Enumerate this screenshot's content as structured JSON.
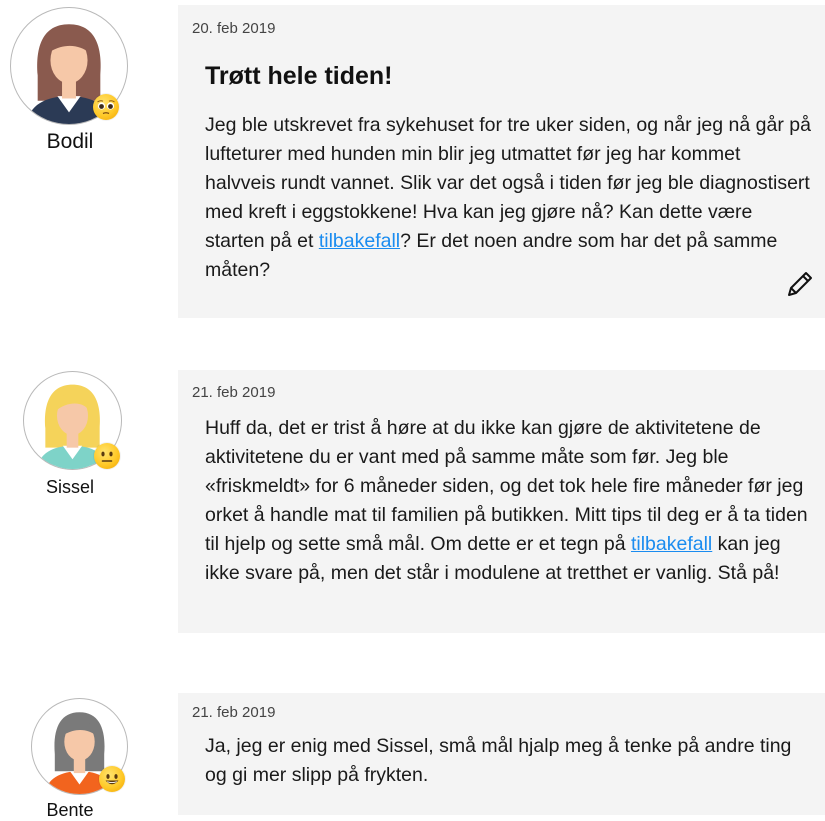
{
  "posts": [
    {
      "author": "Bodil",
      "mood_icon": "pleading-face-icon",
      "hair_color": "#8a5a4e",
      "shirt_color": "#2b3a55",
      "date": "20. feb 2019",
      "title": "Trøtt hele tiden!",
      "body_before": "Jeg ble utskrevet fra sykehuset for tre uker siden, og når jeg nå går på lufteturer med hunden min blir jeg utmattet før jeg har kommet halvveis rundt vannet. Slik var det også i tiden før jeg ble diagnostisert med kreft i eggstokkene! Hva kan jeg gjøre nå? Kan dette være starten på et ",
      "link": "tilbakefall",
      "body_after": "? Er det noen andre som har det på samme måten?",
      "edit_icon": "pencil-icon"
    },
    {
      "author": "Sissel",
      "mood_icon": "neutral-face-icon",
      "hair_color": "#f5d35a",
      "shirt_color": "#7ed3c8",
      "date": "21. feb 2019",
      "body_before": "Huff da, det er trist å høre at du ikke kan gjøre de aktivitetene de aktivitetene du er vant med på samme måte som før. Jeg ble «friskmeldt» for 6 måneder siden, og det tok hele fire måneder før jeg orket å handle mat til familien på butikken. Mitt tips til deg er å ta tiden til hjelp og sette små mål. Om dette er et tegn på ",
      "link": "tilbakefall",
      "body_after": " kan jeg ikke svare på, men det står i modulene at tretthet er vanlig. Stå på!"
    },
    {
      "author": "Bente",
      "mood_icon": "smiling-face-icon",
      "hair_color": "#7a7a7a",
      "shirt_color": "#f2641e",
      "date": "21. feb 2019",
      "body_before": "Ja, jeg er enig med Sissel, små mål hjalp meg å tenke på andre ting og gi mer slipp på frykten."
    }
  ],
  "colors": {
    "card_background": "#f4f4f4",
    "link": "#1a8cf0",
    "skin": "#f6c8a8"
  }
}
